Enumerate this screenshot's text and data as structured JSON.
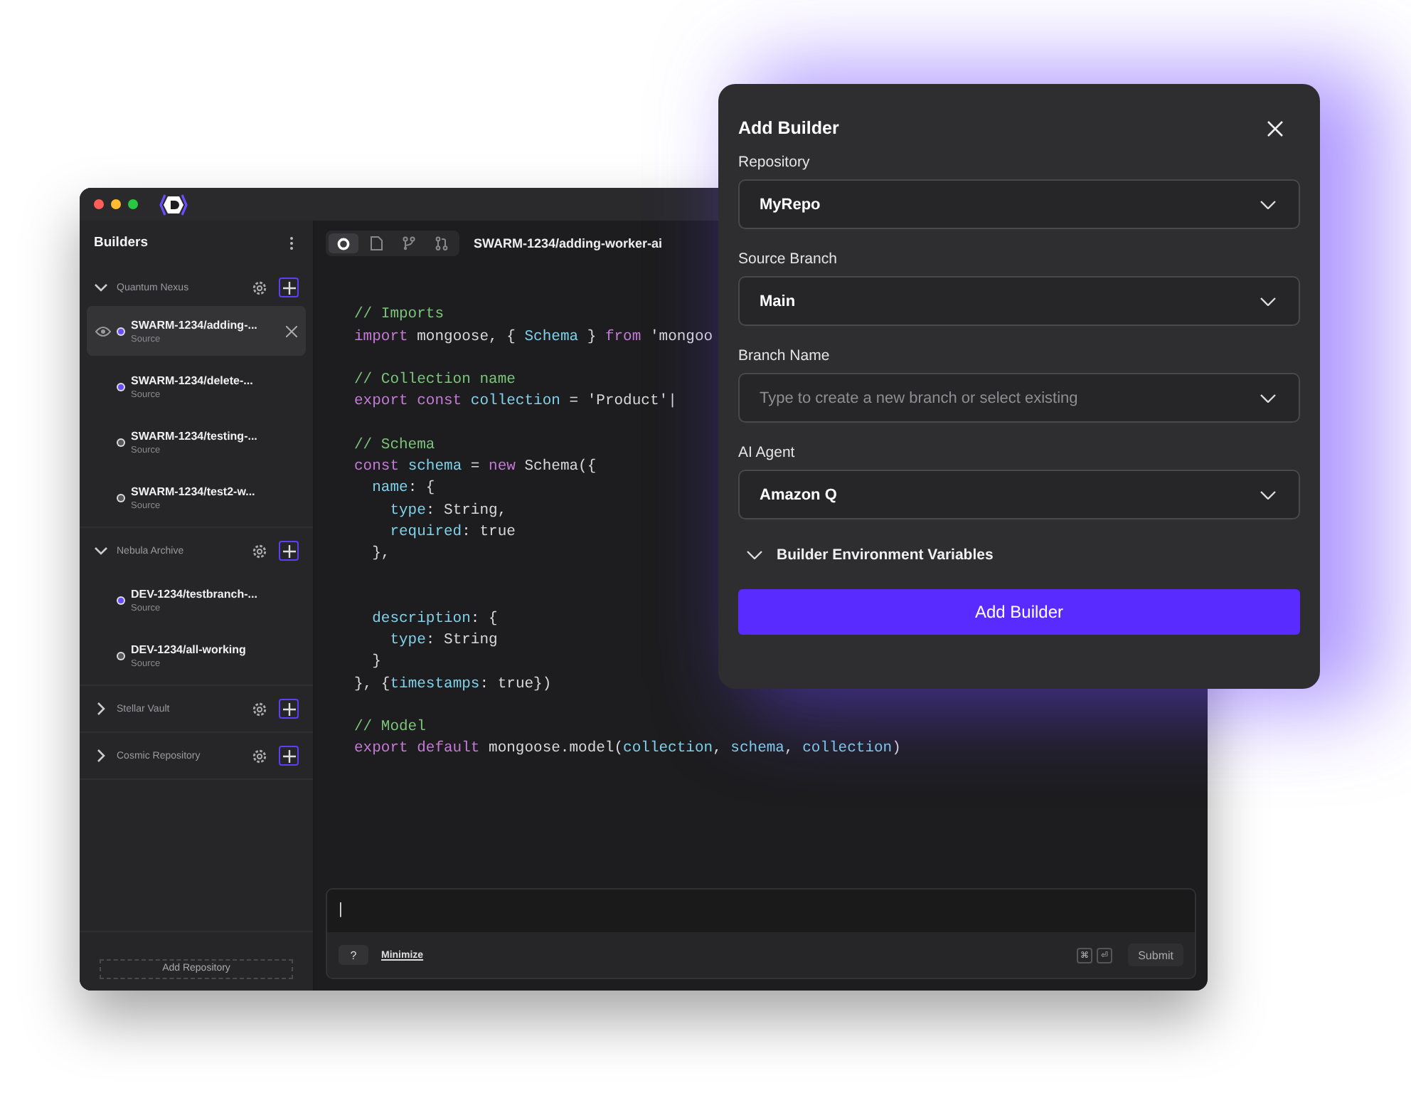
{
  "sidebar": {
    "title": "Builders",
    "groups": [
      {
        "name": "Quantum Nexus",
        "expanded": true,
        "items": [
          {
            "title": "SWARM-1234/adding-...",
            "subtitle": "Source",
            "color": "#6b4dff",
            "selected": true
          },
          {
            "title": "SWARM-1234/delete-...",
            "subtitle": "Source",
            "color": "#6b4dff",
            "selected": false
          },
          {
            "title": "SWARM-1234/testing-...",
            "subtitle": "Source",
            "color": "#5a5a5e",
            "selected": false
          },
          {
            "title": "SWARM-1234/test2-w...",
            "subtitle": "Source",
            "color": "#5a5a5e",
            "selected": false
          }
        ]
      },
      {
        "name": "Nebula Archive",
        "expanded": true,
        "items": [
          {
            "title": "DEV-1234/testbranch-...",
            "subtitle": "Source",
            "color": "#6b4dff",
            "selected": false
          },
          {
            "title": "DEV-1234/all-working",
            "subtitle": "Source",
            "color": "#5a5a5e",
            "selected": false
          }
        ]
      },
      {
        "name": "Stellar Vault",
        "expanded": false
      },
      {
        "name": "Cosmic Repository",
        "expanded": false
      }
    ],
    "add_button": "Add Repository"
  },
  "editor": {
    "tabs": [
      {
        "kind": "circle",
        "selected": true
      },
      {
        "kind": "file",
        "selected": false
      },
      {
        "kind": "branch",
        "selected": false
      },
      {
        "kind": "pull",
        "selected": false
      }
    ],
    "title": "SWARM-1234/adding-worker-ai",
    "blocks": [
      {
        "kind": "section",
        "lines": [
          [
            {
              "kind": "comment",
              "text": "// Imports"
            }
          ],
          [
            {
              "kind": "keyword",
              "text": "import"
            },
            {
              "kind": "plain",
              "text": " mongoose, { "
            },
            {
              "kind": "ident",
              "text": "Schema"
            },
            {
              "kind": "plain",
              "text": " } "
            },
            {
              "kind": "keyword",
              "text": "from"
            },
            {
              "kind": "plain",
              "text": " 'mongoo"
            }
          ]
        ]
      },
      {
        "kind": "section",
        "lines": [
          [
            {
              "kind": "comment",
              "text": "// Collection name"
            }
          ],
          [
            {
              "kind": "keyword",
              "text": "export const"
            },
            {
              "kind": "ident",
              "text": " collection"
            },
            {
              "kind": "plain",
              "text": " = 'Product'"
            },
            {
              "kind": "cursor",
              "text": "|"
            }
          ]
        ]
      },
      {
        "kind": "section",
        "lines": [
          [
            {
              "kind": "comment",
              "text": "// Schema"
            }
          ],
          [
            {
              "kind": "keyword",
              "text": "const"
            },
            {
              "kind": "ident",
              "text": " schema"
            },
            {
              "kind": "plain",
              "text": " = "
            },
            {
              "kind": "keyword",
              "text": "new"
            },
            {
              "kind": "plain",
              "text": " Schema({"
            }
          ],
          [
            {
              "kind": "ident",
              "text": "  name"
            },
            {
              "kind": "plain",
              "text": ": {"
            }
          ],
          [
            {
              "kind": "ident",
              "text": "    type"
            },
            {
              "kind": "plain",
              "text": ": String,"
            }
          ],
          [
            {
              "kind": "ident",
              "text": "    required"
            },
            {
              "kind": "plain",
              "text": ": true"
            }
          ],
          [
            {
              "kind": "plain",
              "text": "  },"
            }
          ]
        ]
      },
      {
        "kind": "continuation",
        "lines": [
          [
            {
              "kind": "ident",
              "text": "  description"
            },
            {
              "kind": "plain",
              "text": ": {"
            }
          ],
          [
            {
              "kind": "ident",
              "text": "    type"
            },
            {
              "kind": "plain",
              "text": ": String"
            }
          ],
          [
            {
              "kind": "plain",
              "text": "  }"
            }
          ],
          [
            {
              "kind": "plain",
              "text": "}, {"
            },
            {
              "kind": "ident",
              "text": "timestamps"
            },
            {
              "kind": "plain",
              "text": ": true})"
            }
          ]
        ]
      },
      {
        "kind": "section",
        "lines": [
          [
            {
              "kind": "comment",
              "text": "// Model"
            }
          ],
          [
            {
              "kind": "keyword",
              "text": "export default"
            },
            {
              "kind": "plain",
              "text": " mongoose.model("
            },
            {
              "kind": "ident",
              "text": "collection"
            },
            {
              "kind": "plain",
              "text": ", "
            },
            {
              "kind": "ident",
              "text": "schema"
            },
            {
              "kind": "plain",
              "text": ", "
            },
            {
              "kind": "ident",
              "text": "collection"
            },
            {
              "kind": "plain",
              "text": ")"
            }
          ]
        ]
      }
    ]
  },
  "prompt": {
    "value": "|",
    "help": "?",
    "minimize": "Minimize",
    "keys": [
      "⌘",
      "⏎"
    ],
    "submit": "Submit"
  },
  "dialog": {
    "title": "Add Builder",
    "fields": [
      {
        "label": "Repository",
        "value": "MyRepo"
      },
      {
        "label": "Source Branch",
        "value": "Main"
      },
      {
        "label": "Branch Name",
        "placeholder": "Type to create a new branch or select existing"
      },
      {
        "label": "AI Agent",
        "value": "Amazon Q"
      }
    ],
    "section": "Builder Environment Variables",
    "submit": "Add Builder"
  }
}
